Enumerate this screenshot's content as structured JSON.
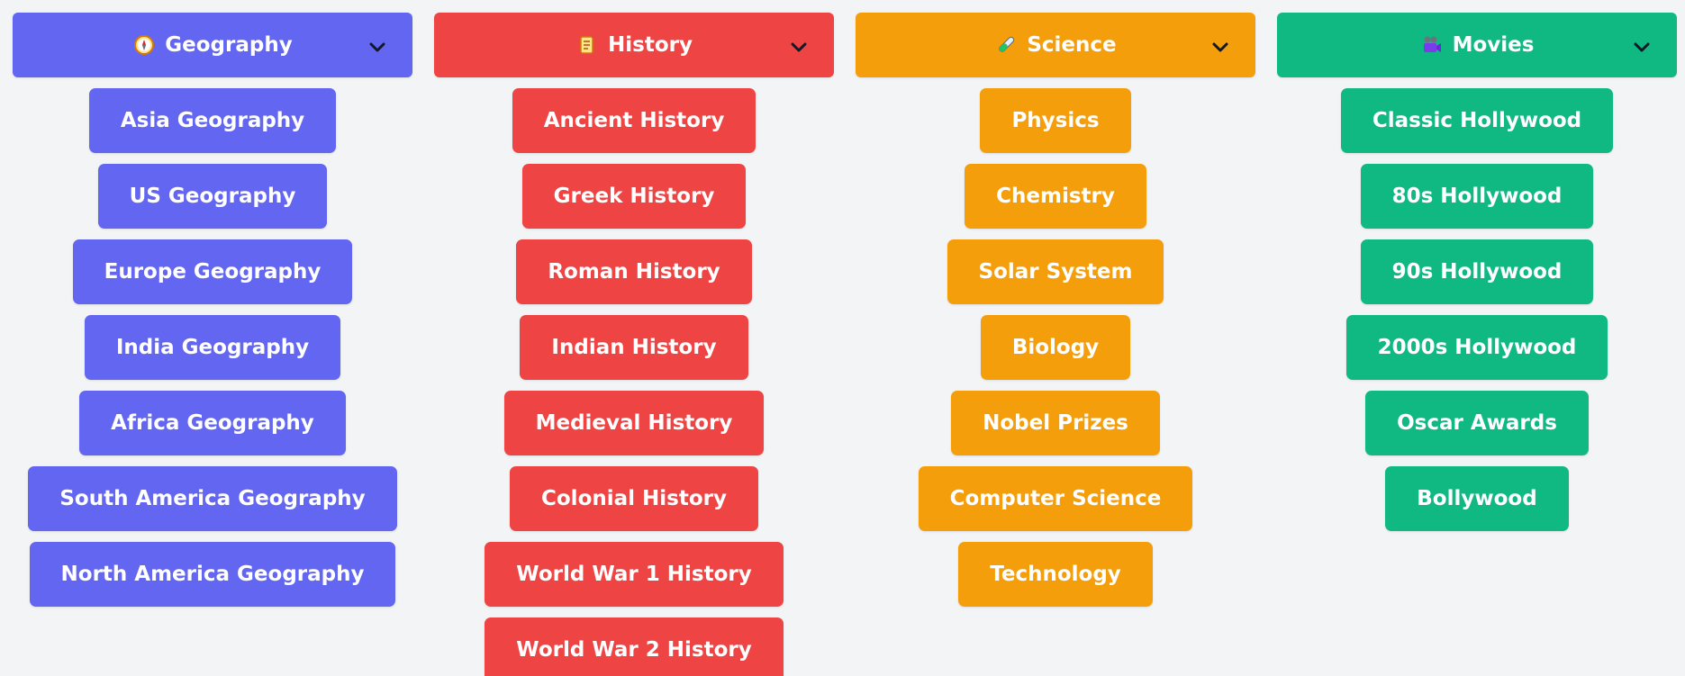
{
  "colors": {
    "geography": "#6366f1",
    "history": "#ef4444",
    "science": "#f59e0b",
    "movies": "#10b981",
    "background": "#f3f4f6"
  },
  "columns": [
    {
      "title": "Geography",
      "icon": "compass-icon",
      "items": [
        "Asia Geography",
        "US Geography",
        "Europe Geography",
        "India Geography",
        "Africa Geography",
        "South America Geography",
        "North America Geography"
      ]
    },
    {
      "title": "History",
      "icon": "scroll-icon",
      "items": [
        "Ancient History",
        "Greek History",
        "Roman History",
        "Indian History",
        "Medieval History",
        "Colonial History",
        "World War 1 History",
        "World War 2 History"
      ]
    },
    {
      "title": "Science",
      "icon": "test-tube-icon",
      "items": [
        "Physics",
        "Chemistry",
        "Solar System",
        "Biology",
        "Nobel Prizes",
        "Computer Science",
        "Technology"
      ]
    },
    {
      "title": "Movies",
      "icon": "movie-camera-icon",
      "items": [
        "Classic Hollywood",
        "80s Hollywood",
        "90s Hollywood",
        "2000s Hollywood",
        "Oscar Awards",
        "Bollywood"
      ]
    }
  ]
}
